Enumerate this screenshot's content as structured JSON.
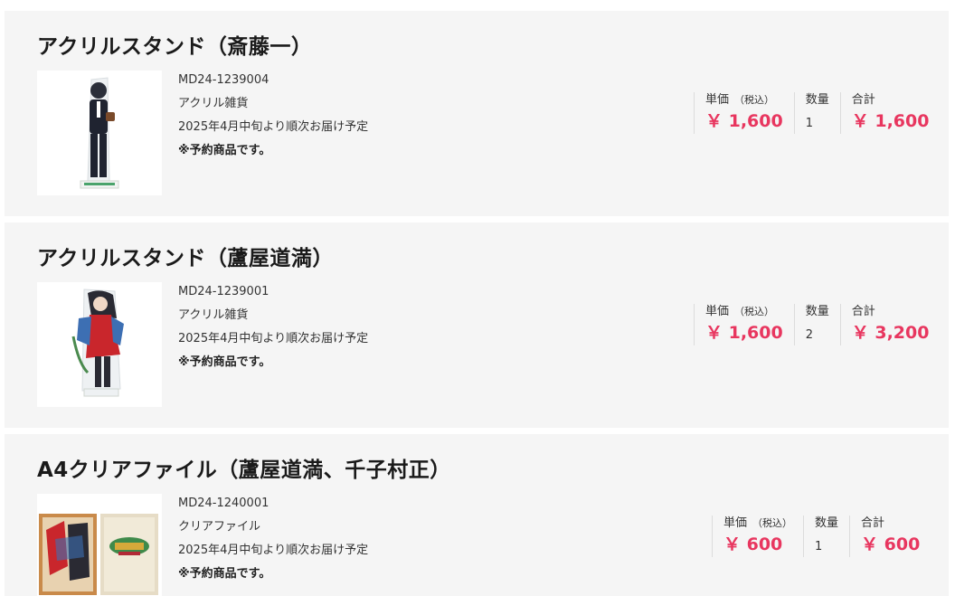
{
  "items": [
    {
      "title": "アクリルスタンド（斎藤一）",
      "code": "MD24-1239004",
      "category": "アクリル雑貨",
      "delivery": "2025年4月中旬より順次お届け予定",
      "note": "※予約商品です。",
      "unit_price_label": "単価",
      "tax_label": "（税込）",
      "unit_price": "￥ 1,600",
      "qty_label": "数量",
      "qty": "1",
      "total_label": "合計",
      "total": "￥ 1,600",
      "thumb_icon": "acrylic-stand-figure"
    },
    {
      "title": "アクリルスタンド（蘆屋道満）",
      "code": "MD24-1239001",
      "category": "アクリル雑貨",
      "delivery": "2025年4月中旬より順次お届け予定",
      "note": "※予約商品です。",
      "unit_price_label": "単価",
      "tax_label": "（税込）",
      "unit_price": "￥ 1,600",
      "qty_label": "数量",
      "qty": "2",
      "total_label": "合計",
      "total": "￥ 3,200",
      "thumb_icon": "acrylic-stand-figure"
    },
    {
      "title": "A4クリアファイル（蘆屋道満、千子村正）",
      "code": "MD24-1240001",
      "category": "クリアファイル",
      "delivery": "2025年4月中旬より順次お届け予定",
      "note": "※予約商品です。",
      "unit_price_label": "単価",
      "tax_label": "（税込）",
      "unit_price": "￥ 600",
      "qty_label": "数量",
      "qty": "1",
      "total_label": "合計",
      "total": "￥ 600",
      "thumb_icon": "clear-file"
    }
  ],
  "colors": {
    "price": "#e8365f",
    "card_bg": "#f5f5f5"
  }
}
